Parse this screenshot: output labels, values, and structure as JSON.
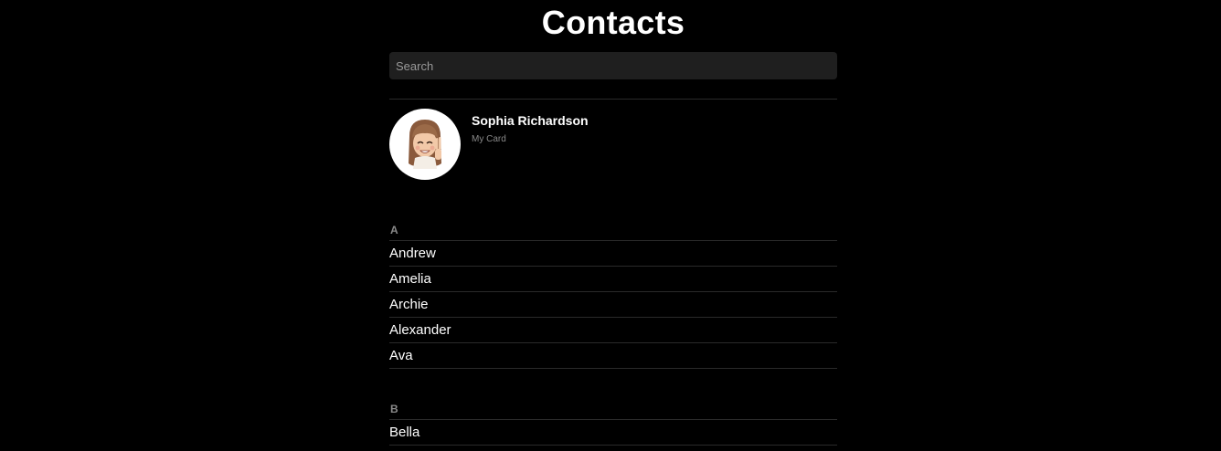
{
  "header": {
    "title": "Contacts"
  },
  "search": {
    "placeholder": "Search",
    "value": ""
  },
  "my_card": {
    "name": "Sophia Richardson",
    "subtitle": "My Card",
    "avatar_icon": "memoji-avatar-icon"
  },
  "sections": [
    {
      "letter": "A",
      "contacts": [
        "Andrew",
        "Amelia",
        "Archie",
        "Alexander",
        "Ava"
      ]
    },
    {
      "letter": "B",
      "contacts": [
        "Bella"
      ]
    }
  ],
  "colors": {
    "background": "#000000",
    "search_field": "#1f1f1f",
    "divider": "#2a2a2a",
    "secondary_text": "#8a8a8a"
  }
}
